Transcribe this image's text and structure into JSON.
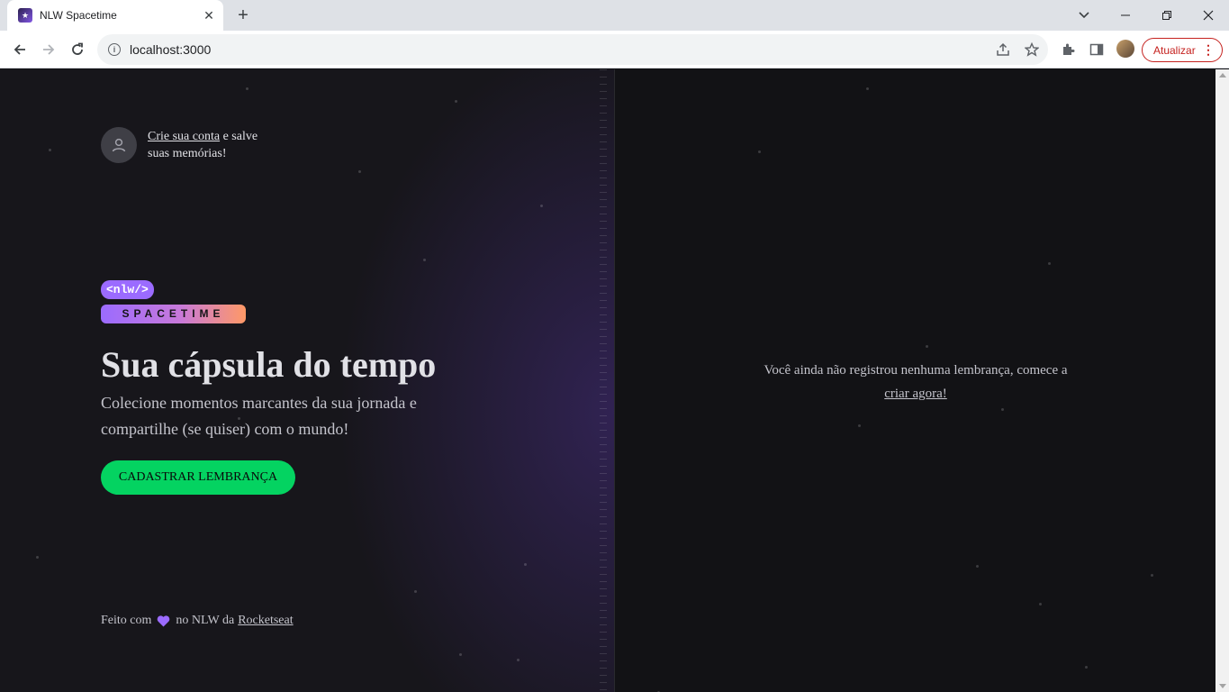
{
  "browser": {
    "tab_title": "NLW Spacetime",
    "url": "localhost:3000",
    "update_label": "Atualizar"
  },
  "page": {
    "signin": {
      "link_text": "Crie sua conta",
      "rest_text": " e salve suas memórias!"
    },
    "logo": {
      "top": "<nlw/>",
      "bottom": "SPACETIME"
    },
    "headline": "Sua cápsula do tempo",
    "subheadline": "Colecione momentos marcantes da sua jornada e compartilhe (se quiser) com o mundo!",
    "cta_label": "CADASTRAR LEMBRANÇA",
    "footer": {
      "prefix": "Feito com",
      "middle": "no NLW da",
      "link": "Rocketseat"
    },
    "empty_state": {
      "text": "Você ainda não registrou nenhuma lembrança, comece a",
      "link": "criar agora!"
    }
  },
  "colors": {
    "accent_green": "#04d361",
    "accent_purple": "#9b6bff",
    "background": "#121215"
  }
}
